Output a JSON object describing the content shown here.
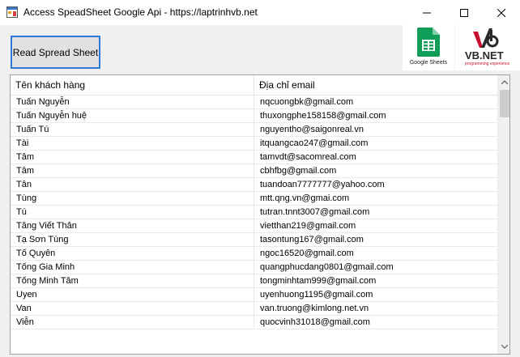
{
  "window": {
    "title": "Access SpeadSheet Google Api - https://laptrinhvb.net",
    "minimize_glyph": "—",
    "maximize_glyph": "☐",
    "close_glyph": "✕"
  },
  "toolbar": {
    "read_button_label": "Read Spread Sheet"
  },
  "logos": {
    "google_sheets_caption": "Google Sheets",
    "vb_word": "VB.NET",
    "vb_sub": "programming experience"
  },
  "grid": {
    "headers": [
      "Tên khách hàng",
      "Địa chỉ email"
    ],
    "rows": [
      {
        "name": "Tuấn Nguyễn",
        "email": "nqcuongbk@gmail.com"
      },
      {
        "name": "Tuấn Nguyễn huệ",
        "email": "thuxongphe158158@gmail.com"
      },
      {
        "name": "Tuấn Tú",
        "email": "nguyentho@saigonreal.vn"
      },
      {
        "name": "Tài",
        "email": "itquangcao247@gmail.com"
      },
      {
        "name": "Tâm",
        "email": "tamvdt@sacomreal.com"
      },
      {
        "name": "Tâm",
        "email": "cbhfbg@gmail.com"
      },
      {
        "name": "Tân",
        "email": "tuandoan7777777@yahoo.com"
      },
      {
        "name": "Tùng",
        "email": "mtt.qng.vn@gmai.com"
      },
      {
        "name": "Tú",
        "email": "tutran.tnnt3007@gmail.com"
      },
      {
        "name": "Tăng Viết Thân",
        "email": "vietthan219@gmail.com"
      },
      {
        "name": "Tạ Sơn Tùng",
        "email": "tasontung167@gmail.com"
      },
      {
        "name": "Tố Quyên",
        "email": "ngoc16520@gmail.com"
      },
      {
        "name": "Tống Gia Minh",
        "email": "quangphucdang0801@gmail.com"
      },
      {
        "name": "Tống Minh Tâm",
        "email": "tongminhtam999@gmail.com"
      },
      {
        "name": "Uyen",
        "email": "uyenhuong1195@gmail.com"
      },
      {
        "name": "Van",
        "email": "van.truong@kimlong.net.vn"
      },
      {
        "name": "Viễn",
        "email": "quocvinh31018@gmail.com"
      }
    ]
  },
  "colors": {
    "button_border": "#2b7bd6",
    "sheets_green": "#0f9d58",
    "vb_red": "#c8102e"
  }
}
